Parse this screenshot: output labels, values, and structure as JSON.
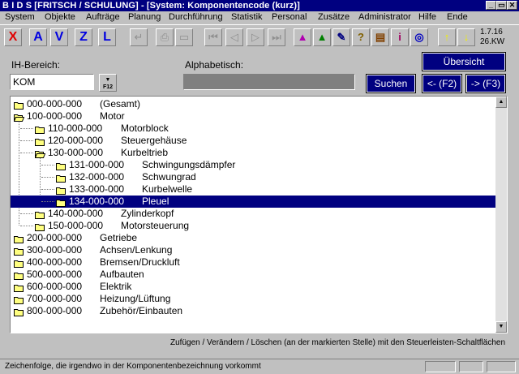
{
  "window": {
    "title": "B I D S  [FRITSCH / SCHULUNG] - [System: Komponentencode (kurz)]",
    "controls": [
      "_",
      "▭",
      "✕"
    ]
  },
  "menu": [
    "System",
    "Objekte",
    "Aufträge",
    "Planung",
    "Durchführung",
    "Statistik",
    "Personal",
    "Zusätze",
    "Administrator",
    "Hilfe",
    "Ende"
  ],
  "toolbar": {
    "letters": [
      "X",
      "A",
      "V",
      "Z",
      "L"
    ],
    "date": "1.7.16",
    "week": "26.KW"
  },
  "filter": {
    "ih_label": "IH-Bereich:",
    "ih_value": "KOM",
    "f12_label": "F12",
    "alpha_label": "Alphabetisch:",
    "alpha_value": "",
    "search_label": "Suchen",
    "overview_label": "Übersicht",
    "prev_label": "<- (F2)",
    "next_label": "-> (F3)"
  },
  "tree": [
    {
      "code": "000-000-000",
      "name": "(Gesamt)",
      "level": 0,
      "open": false,
      "selected": false
    },
    {
      "code": "100-000-000",
      "name": "Motor",
      "level": 0,
      "open": true,
      "selected": false
    },
    {
      "code": "110-000-000",
      "name": "Motorblock",
      "level": 1,
      "open": false,
      "selected": false
    },
    {
      "code": "120-000-000",
      "name": "Steuergehäuse",
      "level": 1,
      "open": false,
      "selected": false
    },
    {
      "code": "130-000-000",
      "name": "Kurbeltrieb",
      "level": 1,
      "open": true,
      "selected": false
    },
    {
      "code": "131-000-000",
      "name": "Schwingungsdämpfer",
      "level": 2,
      "open": false,
      "selected": false
    },
    {
      "code": "132-000-000",
      "name": "Schwungrad",
      "level": 2,
      "open": false,
      "selected": false
    },
    {
      "code": "133-000-000",
      "name": "Kurbelwelle",
      "level": 2,
      "open": false,
      "selected": false
    },
    {
      "code": "134-000-000",
      "name": "Pleuel",
      "level": 2,
      "open": false,
      "selected": true
    },
    {
      "code": "140-000-000",
      "name": "Zylinderkopf",
      "level": 1,
      "open": false,
      "selected": false
    },
    {
      "code": "150-000-000",
      "name": "Motorsteuerung",
      "level": 1,
      "open": false,
      "selected": false
    },
    {
      "code": "200-000-000",
      "name": "Getriebe",
      "level": 0,
      "open": false,
      "selected": false
    },
    {
      "code": "300-000-000",
      "name": "Achsen/Lenkung",
      "level": 0,
      "open": false,
      "selected": false
    },
    {
      "code": "400-000-000",
      "name": "Bremsen/Druckluft",
      "level": 0,
      "open": false,
      "selected": false
    },
    {
      "code": "500-000-000",
      "name": "Aufbauten",
      "level": 0,
      "open": false,
      "selected": false
    },
    {
      "code": "600-000-000",
      "name": "Elektrik",
      "level": 0,
      "open": false,
      "selected": false
    },
    {
      "code": "700-000-000",
      "name": "Heizung/Lüftung",
      "level": 0,
      "open": false,
      "selected": false
    },
    {
      "code": "800-000-000",
      "name": "Zubehör/Einbauten",
      "level": 0,
      "open": false,
      "selected": false
    }
  ],
  "hint": "Zufügen / Verändern / Löschen (an der markierten Stelle) mit den Steuerleisten-Schaltflächen",
  "status": "Zeichenfolge, die irgendwo in der Komponentenbezeichnung vorkommt",
  "colors": {
    "titlebar": "#000080",
    "selection": "#000080",
    "folder": "#ffff80",
    "face": "#c0c0c0"
  }
}
